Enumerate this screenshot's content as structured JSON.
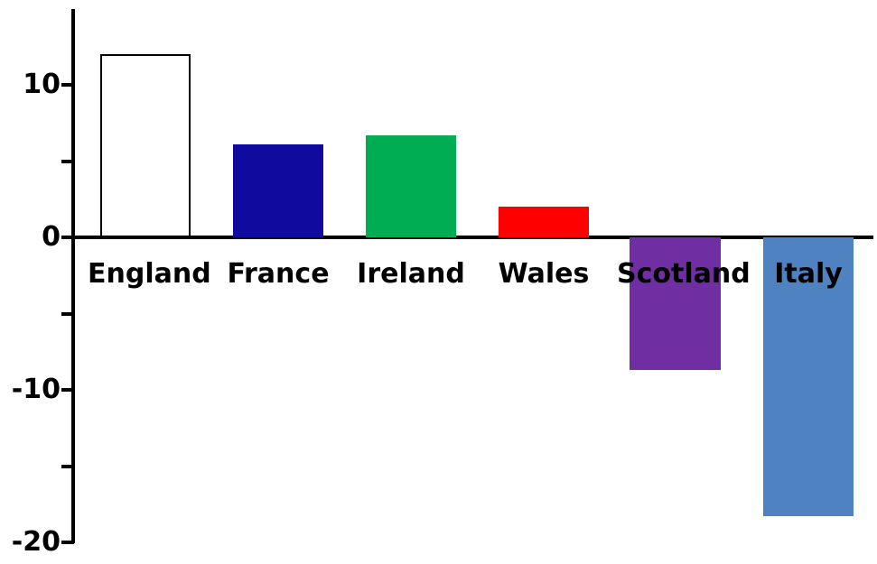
{
  "chart_data": {
    "type": "bar",
    "title": "",
    "subtitle": "",
    "xlabel": "",
    "ylabel": "",
    "categories": [
      "England",
      "France",
      "Ireland",
      "Wales",
      "Scotland",
      "Italy"
    ],
    "values": [
      12.0,
      6.1,
      6.7,
      2.0,
      -8.7,
      -18.3
    ],
    "colors": [
      "#ffffff",
      "#100a9e",
      "#00ad52",
      "#fe0000",
      "#6f2fa3",
      "#4e82c0"
    ],
    "edge_colors": [
      "#000000",
      "#100a9e",
      "#00ad52",
      "#fe0000",
      "#6f2fa3",
      "#4e82c0"
    ],
    "ylim": [
      -20,
      13.5
    ],
    "ytick_labels": [
      "10",
      "0",
      "-10",
      "-20"
    ],
    "ytick_values": [
      10,
      0,
      -10,
      -20
    ],
    "yminor_tick_values": [
      5,
      -5,
      -15
    ],
    "grid": false,
    "legend": false,
    "legend_position": "none",
    "axis_color": "#000000",
    "background": "#ffffff"
  },
  "axis": {
    "labels": [
      {
        "text": "10",
        "value": 10
      },
      {
        "text": "0",
        "value": 0
      },
      {
        "text": "-10",
        "value": -10
      },
      {
        "text": "-20",
        "value": -20
      }
    ]
  },
  "bars": [
    {
      "label": "England",
      "value": 12.0,
      "color": "#ffffff",
      "edge": "#000000"
    },
    {
      "label": "France",
      "value": 6.1,
      "color": "#100a9e",
      "edge": "#100a9e"
    },
    {
      "label": "Ireland",
      "value": 6.7,
      "color": "#00ad52",
      "edge": "#00ad52"
    },
    {
      "label": "Wales",
      "value": 2.0,
      "color": "#fe0000",
      "edge": "#fe0000"
    },
    {
      "label": "Scotland",
      "value": -8.7,
      "color": "#6f2fa3",
      "edge": "#6f2fa3"
    },
    {
      "label": "Italy",
      "value": -18.3,
      "color": "#4e82c0",
      "edge": "#4e82c0"
    }
  ]
}
